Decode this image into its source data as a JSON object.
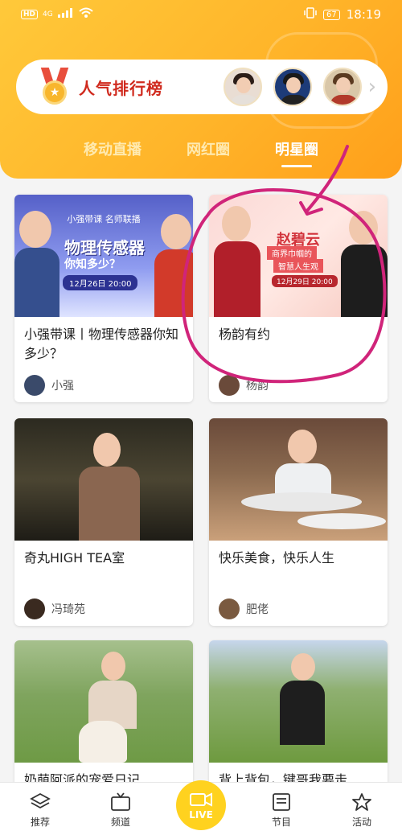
{
  "status_bar": {
    "network": "HD",
    "signal": "4G",
    "battery": "67",
    "time": "18:19"
  },
  "rank": {
    "title": "人气排行榜"
  },
  "tabs": [
    {
      "label": "移动直播",
      "active": false
    },
    {
      "label": "网红圈",
      "active": false
    },
    {
      "label": "明星圈",
      "active": true
    }
  ],
  "cards": [
    {
      "title": "小强带课丨物理传感器你知多少？",
      "author": "小强",
      "promo": {
        "band": "小强带课 名师联播",
        "big": "物理传感器",
        "sub": "你知多少？",
        "date": "12月26日 20:00"
      }
    },
    {
      "title": "杨韵有约",
      "author": "杨韵",
      "promo": {
        "name": "赵碧云",
        "line1": "商界巾帼的",
        "line2": "智慧人生观",
        "date": "12月29日 20:00"
      }
    },
    {
      "title": "奇丸HIGH TEA室",
      "author": "冯琦苑"
    },
    {
      "title": "快乐美食，快乐人生",
      "author": "肥佬"
    },
    {
      "title": "奶萌阿派的宠爱日记",
      "author": ""
    },
    {
      "title": "背上背包，键哥我要走",
      "author": ""
    }
  ],
  "bottom_nav": [
    {
      "label": "推荐",
      "icon": "layers-icon"
    },
    {
      "label": "频道",
      "icon": "tv-icon"
    },
    {
      "label": "LIVE",
      "icon": "camera-icon"
    },
    {
      "label": "节目",
      "icon": "program-icon"
    },
    {
      "label": "活动",
      "icon": "star-icon"
    }
  ],
  "colors": {
    "header": "#ffb52a",
    "accent": "#ffd21f",
    "rank_title": "#d02a1e",
    "annotation": "#d0247a"
  }
}
